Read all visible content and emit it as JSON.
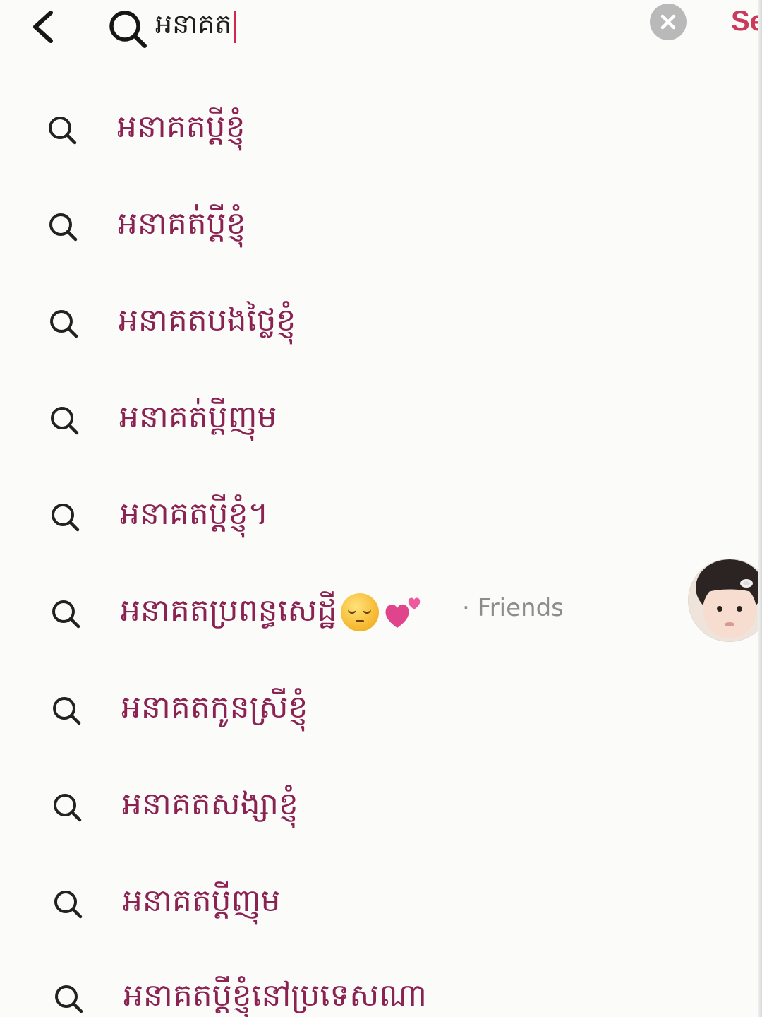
{
  "header": {
    "back_icon": "chevron-left-icon",
    "search_icon": "search-icon",
    "query": "អនាគត",
    "clear_icon": "close-circle-icon",
    "submit_label": "Se"
  },
  "colors": {
    "accent": "#c93a5c",
    "caret": "#d2264f",
    "suggestion_text": "#8a2352",
    "secondary_text": "#8c8c8c",
    "background": "#fbfbf9"
  },
  "suggestions": [
    {
      "label": "អនាគតប្ដីខ្ញុំ",
      "icon": "search-icon"
    },
    {
      "label": "អនាគត់ប្តីខ្ញុំ",
      "icon": "search-icon"
    },
    {
      "label": "អនាគតបងថ្លៃខ្ញុំ",
      "icon": "search-icon"
    },
    {
      "label": "អនាគត់ប្តីញុម",
      "icon": "search-icon"
    },
    {
      "label": "អនាគតប្តីខ្ញុំ។",
      "icon": "search-icon"
    },
    {
      "label": "អនាគតប្រពន្ធសេដ្ឋី",
      "icon": "search-icon",
      "emojis": [
        "pensive-face-icon",
        "two-hearts-icon"
      ],
      "tag": "· Friends",
      "avatar": "avatar-icon"
    },
    {
      "label": "អនាគតកូនស្រីខ្ញុំ",
      "icon": "search-icon"
    },
    {
      "label": "អនាគតសង្សាខ្ញុំ",
      "icon": "search-icon"
    },
    {
      "label": "អនាគតប្តីញុម",
      "icon": "search-icon"
    },
    {
      "label": "អនាគតប្តីខ្ញុំនៅប្រទេសណា",
      "icon": "search-icon"
    }
  ]
}
